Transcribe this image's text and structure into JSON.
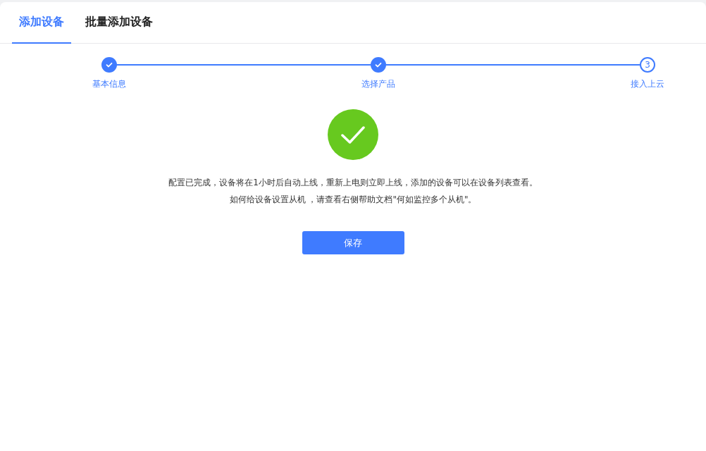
{
  "tabs": [
    {
      "label": "添加设备",
      "selected": true
    },
    {
      "label": "批量添加设备",
      "selected": false
    }
  ],
  "steps": [
    {
      "label": "基本信息",
      "done": true
    },
    {
      "label": "选择产品",
      "done": true
    },
    {
      "label": "接入上云",
      "done": false,
      "number": "3"
    }
  ],
  "result": {
    "success": true,
    "lines": [
      "配置已完成，设备将在1小时后自动上线，重新上电则立即上线，添加的设备可以在设备列表查看。",
      "如何给设备设置从机 ，请查看右侧帮助文档\"何如监控多个从机\"。"
    ]
  },
  "buttons": [
    {
      "label": "保存"
    }
  ]
}
